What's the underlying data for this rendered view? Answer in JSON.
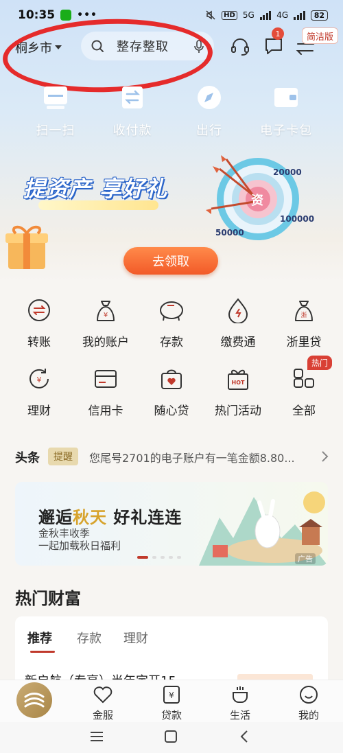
{
  "status_bar": {
    "time": "10:35",
    "hd": "HD",
    "network_1": "5G",
    "network_2": "4G",
    "battery": "82"
  },
  "header": {
    "city": "桐乡市",
    "search_placeholder": "整存整取",
    "message_count": "1",
    "simple_mode_label": "简洁版"
  },
  "quick_actions": [
    {
      "label": "扫一扫",
      "icon": "scan-icon"
    },
    {
      "label": "收付款",
      "icon": "payment-code-icon"
    },
    {
      "label": "出行",
      "icon": "compass-icon"
    },
    {
      "label": "电子卡包",
      "icon": "wallet-icon"
    }
  ],
  "banner": {
    "title": "提资产 享好礼",
    "cta": "去领取",
    "target_center": "资",
    "target_values": [
      "20000",
      "100000",
      "50000"
    ]
  },
  "services": [
    {
      "label": "转账",
      "icon": "transfer-icon"
    },
    {
      "label": "我的账户",
      "icon": "account-bag-icon"
    },
    {
      "label": "存款",
      "icon": "piggy-bank-icon"
    },
    {
      "label": "缴费通",
      "icon": "bill-pay-icon"
    },
    {
      "label": "浙里贷",
      "icon": "loan-bag-icon"
    },
    {
      "label": "理财",
      "icon": "wealth-refresh-icon"
    },
    {
      "label": "信用卡",
      "icon": "credit-card-icon"
    },
    {
      "label": "随心贷",
      "icon": "heart-bag-icon"
    },
    {
      "label": "热门活动",
      "icon": "hot-gift-icon"
    },
    {
      "label": "全部",
      "icon": "grid-all-icon"
    }
  ],
  "hot_badge": "热门",
  "hot_icon_text": "HOT",
  "headline": {
    "title": "头条",
    "tag": "提醒",
    "text": "您尾号2701的电子账户有一笔金额8.80..."
  },
  "ad": {
    "title_part1": "邂逅",
    "title_highlight": "秋天",
    "title_part2": " 好礼连连",
    "subtitle_1": "金秋丰收季",
    "subtitle_2": "一起加载秋日福利",
    "tag": "广告"
  },
  "wealth": {
    "title": "热门财富",
    "tabs": [
      "推荐",
      "存款",
      "理财"
    ],
    "product_peek": "新启航（专享）半年定开15"
  },
  "bottom_nav": [
    {
      "label": "金服",
      "icon": "heart-outline-icon"
    },
    {
      "label": "贷款",
      "icon": "yuan-note-icon"
    },
    {
      "label": "生活",
      "icon": "coffee-cup-icon"
    },
    {
      "label": "我的",
      "icon": "smiley-icon"
    }
  ],
  "colors": {
    "accent_red": "#c0392b",
    "cta_orange": "#f25a28",
    "annotation_red": "#e52b2b"
  }
}
